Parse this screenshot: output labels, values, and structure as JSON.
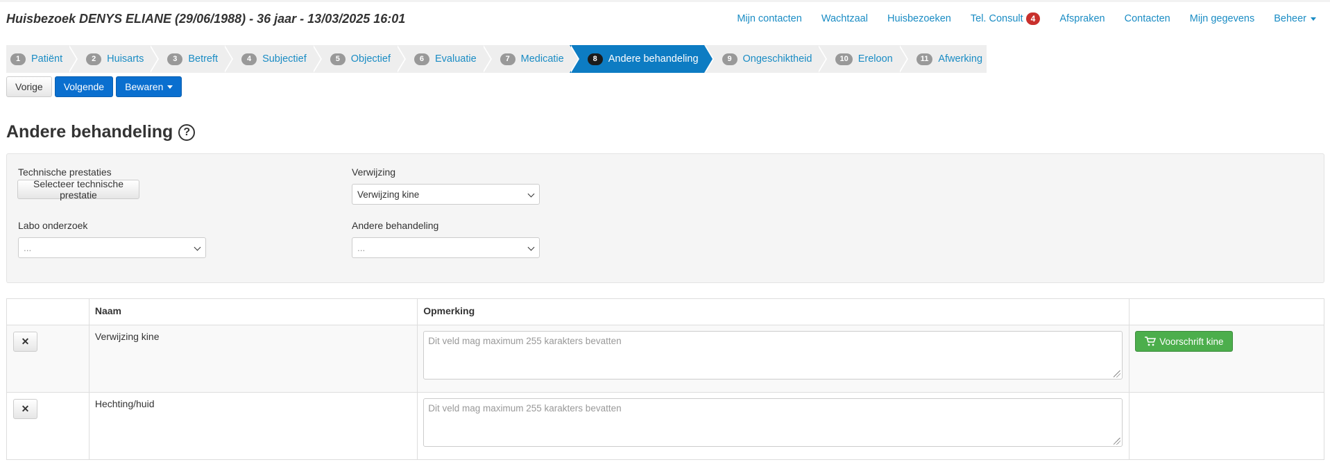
{
  "header": {
    "title": "Huisbezoek DENYS ELIANE (29/06/1988) - 36 jaar - 13/03/2025 16:01"
  },
  "topnav": {
    "items": [
      {
        "label": "Mijn contacten"
      },
      {
        "label": "Wachtzaal"
      },
      {
        "label": "Huisbezoeken"
      },
      {
        "label": "Tel. Consult",
        "badge": "4"
      },
      {
        "label": "Afspraken"
      },
      {
        "label": "Contacten"
      },
      {
        "label": "Mijn gegevens"
      },
      {
        "label": "Beheer"
      }
    ]
  },
  "steps": [
    {
      "num": "1",
      "label": "Patiënt"
    },
    {
      "num": "2",
      "label": "Huisarts"
    },
    {
      "num": "3",
      "label": "Betreft"
    },
    {
      "num": "4",
      "label": "Subjectief"
    },
    {
      "num": "5",
      "label": "Objectief"
    },
    {
      "num": "6",
      "label": "Evaluatie"
    },
    {
      "num": "7",
      "label": "Medicatie"
    },
    {
      "num": "8",
      "label": "Andere behandeling",
      "active": true
    },
    {
      "num": "9",
      "label": "Ongeschiktheid"
    },
    {
      "num": "10",
      "label": "Ereloon"
    },
    {
      "num": "11",
      "label": "Afwerking"
    }
  ],
  "actions": {
    "prev": "Vorige",
    "next": "Volgende",
    "save": "Bewaren"
  },
  "section": {
    "title": "Andere behandeling",
    "help": "?"
  },
  "form": {
    "technical_label": "Technische prestaties",
    "technical_button": "Selecteer technische prestatie",
    "referral_label": "Verwijzing",
    "referral_value": "Verwijzing kine",
    "lab_label": "Labo onderzoek",
    "lab_value": "...",
    "other_label": "Andere behandeling",
    "other_value": "..."
  },
  "table": {
    "headers": [
      "",
      "Naam",
      "Opmerking",
      ""
    ],
    "remove_label": "✕",
    "rows": [
      {
        "name": "Verwijzing kine",
        "placeholder": "Dit veld mag maximum 255 karakters bevatten",
        "action": "Voorschrift kine"
      },
      {
        "name": "Hechting/huid",
        "placeholder": "Dit veld mag maximum 255 karakters bevatten",
        "action": ""
      }
    ]
  },
  "colors": {
    "primary": "#0a6fcf",
    "active_step": "#0d7cc3",
    "link": "#1a8cc4",
    "success": "#4cae4c",
    "badge": "#c9302c"
  }
}
